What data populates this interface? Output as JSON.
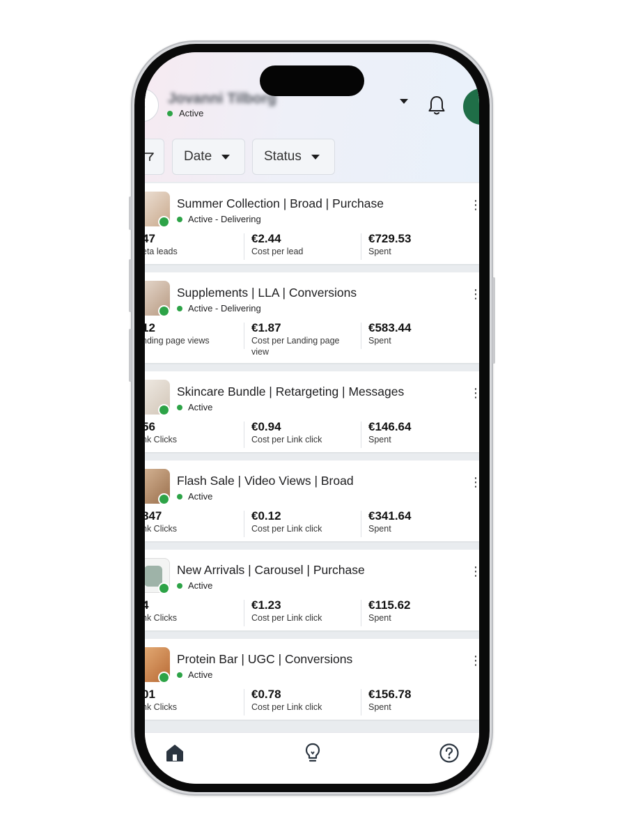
{
  "header": {
    "account_name": "Jovanni Tilborg",
    "account_status": "Active"
  },
  "filters": [
    {
      "label": "Date"
    },
    {
      "label": "Status"
    }
  ],
  "campaigns": [
    {
      "title": "Summer Collection | Broad | Purchase",
      "status": "Active - Delivering",
      "metric1_value": "47",
      "metric1_label": "eta leads",
      "metric2_value": "€2.44",
      "metric2_label": "Cost per lead",
      "metric3_value": "€729.53",
      "metric3_label": "Spent"
    },
    {
      "title": "Supplements | LLA | Conversions",
      "status": "Active - Delivering",
      "metric1_value": "12",
      "metric1_label": "nding page views",
      "metric2_value": "€1.87",
      "metric2_label": "Cost per Landing page view",
      "metric3_value": "€583.44",
      "metric3_label": "Spent"
    },
    {
      "title": "Skincare Bundle | Retargeting | Messages",
      "status": "Active",
      "metric1_value": "56",
      "metric1_label": "nk Clicks",
      "metric2_value": "€0.94",
      "metric2_label": "Cost per Link click",
      "metric3_value": "€146.64",
      "metric3_label": "Spent"
    },
    {
      "title": "Flash Sale | Video Views | Broad",
      "status": "Active",
      "metric1_value": "847",
      "metric1_label": "nk Clicks",
      "metric2_value": "€0.12",
      "metric2_label": "Cost per Link click",
      "metric3_value": "€341.64",
      "metric3_label": "Spent"
    },
    {
      "title": "New Arrivals | Carousel | Purchase",
      "status": "Active",
      "metric1_value": "4",
      "metric1_label": "nk Clicks",
      "metric2_value": "€1.23",
      "metric2_label": "Cost per Link click",
      "metric3_value": "€115.62",
      "metric3_label": "Spent"
    },
    {
      "title": "Protein Bar | UGC | Conversions",
      "status": "Active",
      "metric1_value": "01",
      "metric1_label": "nk Clicks",
      "metric2_value": "€0.78",
      "metric2_label": "Cost per Link click",
      "metric3_value": "€156.78",
      "metric3_label": "Spent"
    }
  ],
  "colors": {
    "active_green": "#2da347",
    "brand_green": "#1f6e47",
    "icon_dark": "#2b3540"
  },
  "icons": {
    "nav": [
      "home-icon",
      "lightbulb-icon",
      "help-icon"
    ],
    "header": [
      "bell-icon",
      "chevron-down-icon",
      "filter-icon"
    ]
  }
}
